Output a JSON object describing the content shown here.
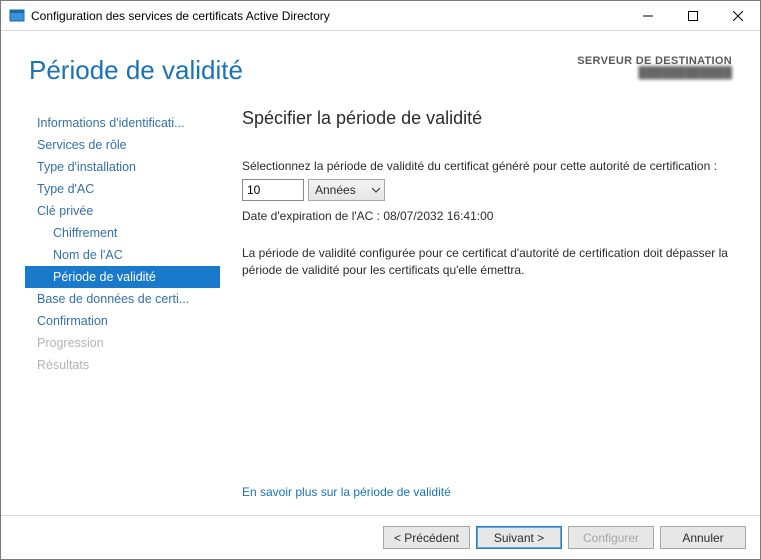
{
  "window": {
    "title": "Configuration des services de certificats Active Directory"
  },
  "header": {
    "title": "Période de validité",
    "destination_label": "SERVEUR DE DESTINATION",
    "destination_value": "████████████"
  },
  "sidebar": {
    "items": [
      {
        "label": "Informations d'identificati...",
        "indent": false,
        "selected": false,
        "disabled": false
      },
      {
        "label": "Services de rôle",
        "indent": false,
        "selected": false,
        "disabled": false
      },
      {
        "label": "Type d'installation",
        "indent": false,
        "selected": false,
        "disabled": false
      },
      {
        "label": "Type d'AC",
        "indent": false,
        "selected": false,
        "disabled": false
      },
      {
        "label": "Clé privée",
        "indent": false,
        "selected": false,
        "disabled": false
      },
      {
        "label": "Chiffrement",
        "indent": true,
        "selected": false,
        "disabled": false
      },
      {
        "label": "Nom de l'AC",
        "indent": true,
        "selected": false,
        "disabled": false
      },
      {
        "label": "Période de validité",
        "indent": true,
        "selected": true,
        "disabled": false
      },
      {
        "label": "Base de données de certi...",
        "indent": false,
        "selected": false,
        "disabled": false
      },
      {
        "label": "Confirmation",
        "indent": false,
        "selected": false,
        "disabled": false
      },
      {
        "label": "Progression",
        "indent": false,
        "selected": false,
        "disabled": true
      },
      {
        "label": "Résultats",
        "indent": false,
        "selected": false,
        "disabled": true
      }
    ]
  },
  "main": {
    "title": "Spécifier la période de validité",
    "select_label": "Sélectionnez la période de validité du certificat généré pour cette autorité de certification :",
    "period_value": "10",
    "period_unit": "Années",
    "expiry_text": "Date d'expiration de l'AC : 08/07/2032 16:41:00",
    "note": "La période de validité configurée pour ce certificat d'autorité de certification doit dépasser la période de validité pour les certificats qu'elle émettra.",
    "learn_more": "En savoir plus sur la période de validité"
  },
  "footer": {
    "previous": "< Précédent",
    "next": "Suivant >",
    "configure": "Configurer",
    "cancel": "Annuler"
  }
}
